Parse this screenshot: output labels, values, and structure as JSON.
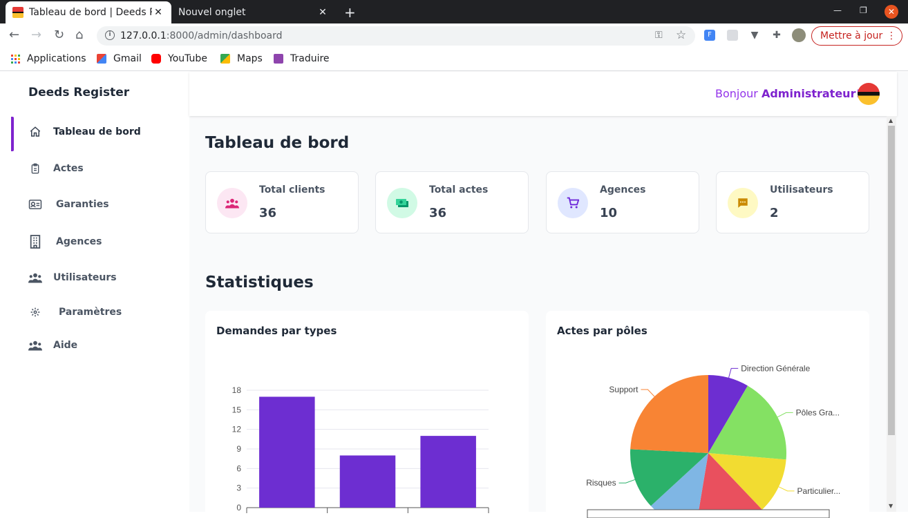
{
  "browser": {
    "tabs": [
      {
        "label": "Tableau de bord | Deeds Register",
        "active": true
      },
      {
        "label": "Nouvel onglet",
        "active": false
      }
    ],
    "new_tab_symbol": "+",
    "url_host": "127.0.0.1",
    "url_path": ":8000/admin/dashboard",
    "update_button": "Mettre à jour",
    "bookmarks": [
      "Applications",
      "Gmail",
      "YouTube",
      "Maps",
      "Traduire"
    ]
  },
  "app": {
    "brand": "Deeds Register",
    "greeting_prefix": "Bonjour ",
    "greeting_name": "Administrateur",
    "greeting_suffix": "!",
    "nav": [
      {
        "label": "Tableau de bord",
        "icon": "home-icon"
      },
      {
        "label": "Actes",
        "icon": "clipboard-icon"
      },
      {
        "label": "Garanties",
        "icon": "id-card-icon"
      },
      {
        "label": "Agences",
        "icon": "building-icon"
      },
      {
        "label": "Utilisateurs",
        "icon": "users-icon"
      },
      {
        "label": "Paramètres",
        "icon": "gear-icon"
      },
      {
        "label": "Aide",
        "icon": "users-icon"
      }
    ],
    "page_title": "Tableau de bord",
    "cards": [
      {
        "label": "Total clients",
        "value": "36",
        "icon": "users-icon",
        "color": "#db2777",
        "bg": "#fce7f3"
      },
      {
        "label": "Total actes",
        "value": "36",
        "icon": "money-icon",
        "color": "#059669",
        "bg": "#d1fae5"
      },
      {
        "label": "Agences",
        "value": "10",
        "icon": "cart-icon",
        "color": "#6d28d9",
        "bg": "#e0e7ff"
      },
      {
        "label": "Utilisateurs",
        "value": "2",
        "icon": "chat-icon",
        "color": "#ca8a04",
        "bg": "#fef9c3"
      }
    ],
    "section_title": "Statistiques"
  },
  "chart_data": [
    {
      "type": "bar",
      "title": "Demandes par types",
      "categories": [
        "",
        "",
        ""
      ],
      "values": [
        17,
        8,
        11
      ],
      "ylim": [
        0,
        18
      ],
      "yticks": [
        "0",
        "3",
        "6",
        "9",
        "12",
        "15",
        "18"
      ],
      "color": "#6d2ed1"
    },
    {
      "type": "pie",
      "title": "Actes par pôles",
      "labels": [
        "Direction Générale",
        "Pôles Gra...",
        "Particulier...",
        "",
        "",
        "Risques",
        "Support"
      ],
      "values": [
        8,
        17,
        11,
        14,
        10,
        12,
        23
      ],
      "colors": [
        "#6d2ed1",
        "#84e163",
        "#f2dc31",
        "#e9505e",
        "#7fb6e4",
        "#2bb16a",
        "#f88434"
      ]
    }
  ]
}
